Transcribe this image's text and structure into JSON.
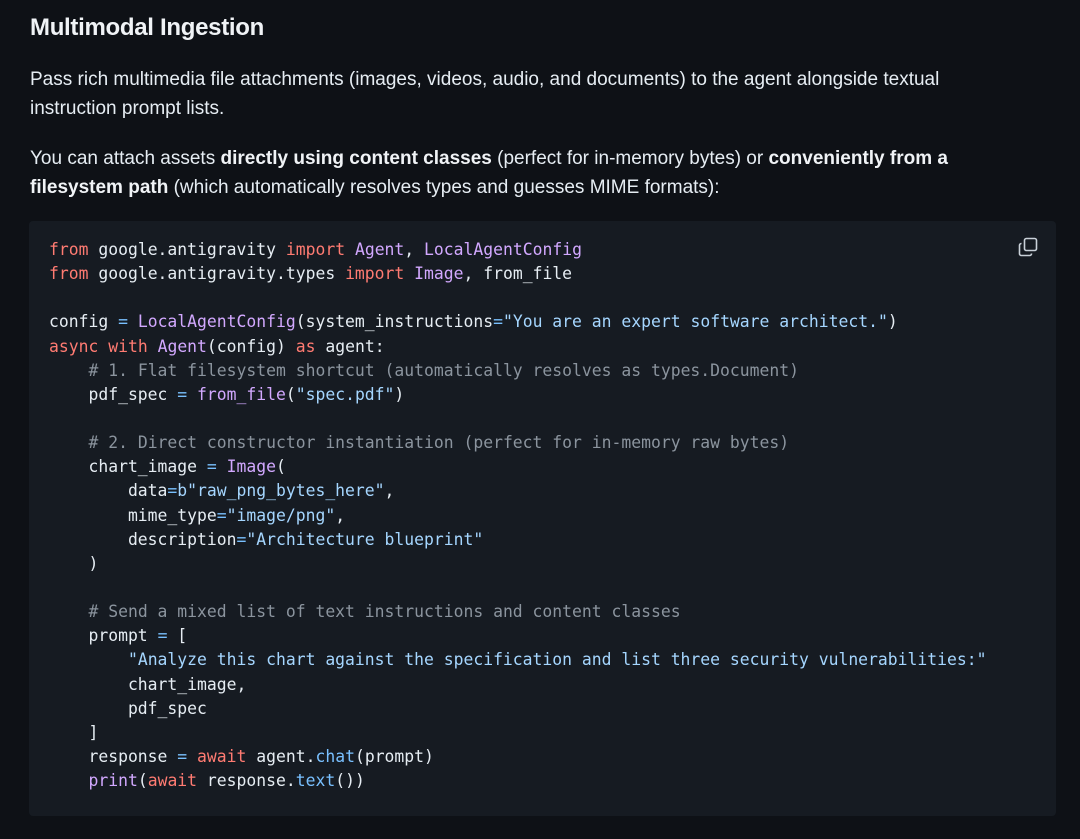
{
  "section": {
    "title": "Multimodal Ingestion"
  },
  "para1": {
    "text": "Pass rich multimedia file attachments (images, videos, audio, and documents) to the agent alongside textual instruction prompt lists."
  },
  "para2": {
    "t1": "You can attach assets ",
    "b1": "directly using content classes",
    "t2": " (perfect for in-memory bytes) or ",
    "b2": "conveniently from a filesystem path",
    "t3": " (which automatically resolves types and guesses MIME formats):"
  },
  "code": {
    "copy_icon": "copy-icon",
    "lines": [
      [
        [
          "kw",
          "from"
        ],
        [
          "t",
          " google.antigravity "
        ],
        [
          "kw",
          "import"
        ],
        [
          "t",
          " "
        ],
        [
          "fn",
          "Agent"
        ],
        [
          "t",
          ", "
        ],
        [
          "fn",
          "LocalAgentConfig"
        ]
      ],
      [
        [
          "kw",
          "from"
        ],
        [
          "t",
          " google.antigravity.types "
        ],
        [
          "kw",
          "import"
        ],
        [
          "t",
          " "
        ],
        [
          "fn",
          "Image"
        ],
        [
          "t",
          ", from_file"
        ]
      ],
      [],
      [
        [
          "t",
          "config "
        ],
        [
          "op",
          "="
        ],
        [
          "t",
          " "
        ],
        [
          "fn",
          "LocalAgentConfig"
        ],
        [
          "t",
          "(system_instructions"
        ],
        [
          "op",
          "="
        ],
        [
          "str",
          "\"You are an expert software architect.\""
        ],
        [
          "t",
          ")"
        ]
      ],
      [
        [
          "kw",
          "async"
        ],
        [
          "t",
          " "
        ],
        [
          "kw",
          "with"
        ],
        [
          "t",
          " "
        ],
        [
          "fn",
          "Agent"
        ],
        [
          "t",
          "(config) "
        ],
        [
          "kw",
          "as"
        ],
        [
          "t",
          " agent:"
        ]
      ],
      [
        [
          "t",
          "    "
        ],
        [
          "cm",
          "# 1. Flat filesystem shortcut (automatically resolves as types.Document)"
        ]
      ],
      [
        [
          "t",
          "    pdf_spec "
        ],
        [
          "op",
          "="
        ],
        [
          "t",
          " "
        ],
        [
          "fn",
          "from_file"
        ],
        [
          "t",
          "("
        ],
        [
          "str",
          "\"spec.pdf\""
        ],
        [
          "t",
          ")"
        ]
      ],
      [],
      [
        [
          "t",
          "    "
        ],
        [
          "cm",
          "# 2. Direct constructor instantiation (perfect for in-memory raw bytes)"
        ]
      ],
      [
        [
          "t",
          "    chart_image "
        ],
        [
          "op",
          "="
        ],
        [
          "t",
          " "
        ],
        [
          "fn",
          "Image"
        ],
        [
          "t",
          "("
        ]
      ],
      [
        [
          "t",
          "        data"
        ],
        [
          "op",
          "="
        ],
        [
          "str",
          "b\"raw_png_bytes_here\""
        ],
        [
          "t",
          ","
        ]
      ],
      [
        [
          "t",
          "        mime_type"
        ],
        [
          "op",
          "="
        ],
        [
          "str",
          "\"image/png\""
        ],
        [
          "t",
          ","
        ]
      ],
      [
        [
          "t",
          "        description"
        ],
        [
          "op",
          "="
        ],
        [
          "str",
          "\"Architecture blueprint\""
        ]
      ],
      [
        [
          "t",
          "    )"
        ]
      ],
      [],
      [
        [
          "t",
          "    "
        ],
        [
          "cm",
          "# Send a mixed list of text instructions and content classes"
        ]
      ],
      [
        [
          "t",
          "    prompt "
        ],
        [
          "op",
          "="
        ],
        [
          "t",
          " ["
        ]
      ],
      [
        [
          "t",
          "        "
        ],
        [
          "str",
          "\"Analyze this chart against the specification and list three security vulnerabilities:\""
        ]
      ],
      [
        [
          "t",
          "        chart_image,"
        ]
      ],
      [
        [
          "t",
          "        pdf_spec"
        ]
      ],
      [
        [
          "t",
          "    ]"
        ]
      ],
      [
        [
          "t",
          "    response "
        ],
        [
          "op",
          "="
        ],
        [
          "t",
          " "
        ],
        [
          "kw",
          "await"
        ],
        [
          "t",
          " agent."
        ],
        [
          "attr",
          "chat"
        ],
        [
          "t",
          "(prompt)"
        ]
      ],
      [
        [
          "t",
          "    "
        ],
        [
          "fn",
          "print"
        ],
        [
          "t",
          "("
        ],
        [
          "kw",
          "await"
        ],
        [
          "t",
          " response."
        ],
        [
          "attr",
          "text"
        ],
        [
          "t",
          "())"
        ]
      ]
    ]
  }
}
